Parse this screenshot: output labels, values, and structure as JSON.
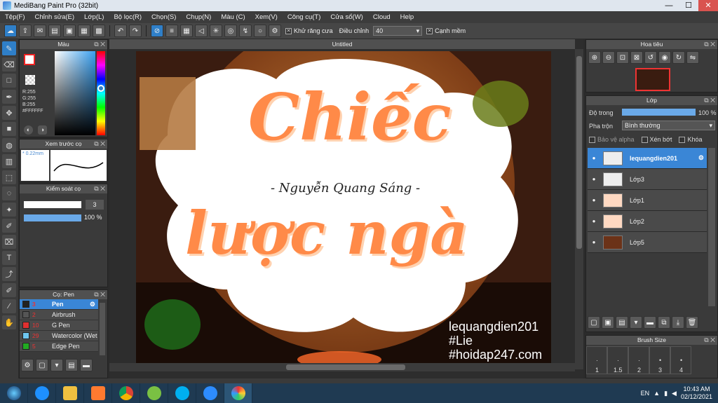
{
  "titlebar": {
    "title": "MediBang Paint Pro (32bit)",
    "min": "—",
    "max": "☐",
    "close": "✕"
  },
  "menu": [
    "Tệp(F)",
    "Chỉnh sửa(E)",
    "Lớp(L)",
    "Bộ lọc(R)",
    "Chọn(S)",
    "Chụp(N)",
    "Màu (C)",
    "Xem(V)",
    "Công cụ(T)",
    "Cửa sổ(W)",
    "Cloud",
    "Help"
  ],
  "toolbar": {
    "antialias_label": "Khử răng cưa",
    "correction_label": "Điều chỉnh",
    "correction_value": "40",
    "smooth_label": "Cạnh mềm"
  },
  "color_panel": {
    "title": "Màu",
    "r": "R:255",
    "g": "G:255",
    "b": "B:255",
    "hex": "#FFFFFF"
  },
  "brush_preview": {
    "title": "Xem trước cọ",
    "size": "0.22mm"
  },
  "brush_control": {
    "title": "Kiểm soát cọ",
    "size_value": "3",
    "opacity_value": "100 %"
  },
  "brush_list": {
    "title": "Cọ: Pen",
    "items": [
      {
        "num": "3",
        "name": "Pen",
        "color": "#222222"
      },
      {
        "num": "2",
        "name": "Airbrush",
        "color": "#555555"
      },
      {
        "num": "10",
        "name": "G Pen",
        "color": "#e03030"
      },
      {
        "num": "29",
        "name": "Watercolor (Wet",
        "color": "#6ec6f0"
      },
      {
        "num": "5",
        "name": "Edge Pen",
        "color": "#22aa22"
      }
    ]
  },
  "canvas": {
    "tab": "Untitled",
    "title_top": "Chiếc",
    "title_bottom": "lược ngà",
    "author": "- Nguyễn Quang Sáng -",
    "credit1": "lequangdien201",
    "credit2": "#Lie",
    "credit3": "#hoidap247.com"
  },
  "navigator": {
    "title": "Hoa tiêu"
  },
  "layer_panel": {
    "title": "Lớp",
    "opacity_label": "Độ trong",
    "opacity_value": "100 %",
    "blend_label": "Pha trộn",
    "blend_value": "Bình thường",
    "protect_alpha": "Bảo vệ alpha",
    "clip": "Xén bớt",
    "lock": "Khóa",
    "layers": [
      "lequangdien201",
      "Lớp3",
      "Lớp1",
      "Lớp2",
      "Lớp5"
    ]
  },
  "brush_size": {
    "title": "Brush Size",
    "sizes": [
      "1",
      "1.5",
      "2",
      "3",
      "4"
    ]
  },
  "taskbar": {
    "lang": "EN",
    "time": "10:43 AM",
    "date": "02/12/2021"
  }
}
